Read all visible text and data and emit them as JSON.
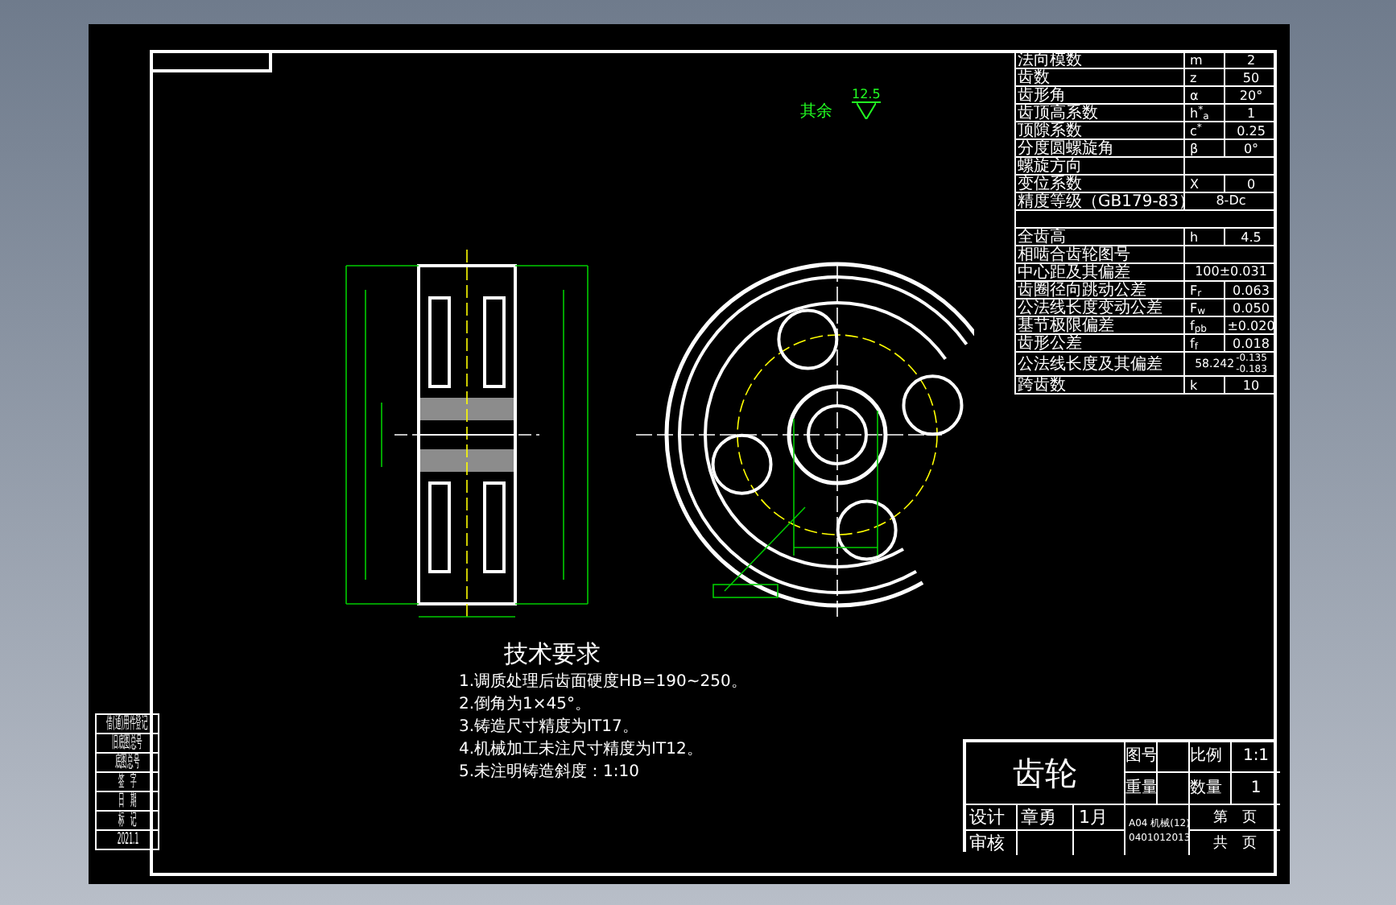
{
  "surface_finish": {
    "label": "其余",
    "value": "12.5"
  },
  "parameters": [
    {
      "kind": "full",
      "name": "法向模数",
      "symbol": "m",
      "value": "2"
    },
    {
      "kind": "full",
      "name": "齿数",
      "symbol": "z",
      "value": "50"
    },
    {
      "kind": "full",
      "name": "齿形角",
      "symbol": "α",
      "value": "20°"
    },
    {
      "kind": "full",
      "name": "齿顶高系数",
      "symbol": "h$^{*}$$_{a}$",
      "value": "1"
    },
    {
      "kind": "full",
      "name": "顶隙系数",
      "symbol": "c$^{*}$",
      "value": "0.25"
    },
    {
      "kind": "full",
      "name": "分度圆螺旋角",
      "symbol": "β",
      "value": "0°"
    },
    {
      "kind": "label",
      "name": "螺旋方向"
    },
    {
      "kind": "full",
      "name": "变位系数",
      "symbol": "X",
      "value": "0"
    },
    {
      "kind": "span",
      "name": "精度等级（GB179-83）",
      "value": "8-Dc"
    },
    {
      "kind": "blank"
    },
    {
      "kind": "full",
      "name": "全齿高",
      "symbol": "h",
      "value": "4.5"
    },
    {
      "kind": "label",
      "name": "相啮合齿轮图号"
    },
    {
      "kind": "span",
      "name": "中心距及其偏差",
      "value": "100±0.031"
    },
    {
      "kind": "full",
      "name": "齿圈径向跳动公差",
      "symbol": "F$_{r}$",
      "value": "0.063"
    },
    {
      "kind": "full",
      "name": "公法线长度变动公差",
      "symbol": "F$_{w}$",
      "value": "0.050"
    },
    {
      "kind": "full",
      "name": "基节极限偏差",
      "symbol": "f$_{pb}$",
      "value": "±0.020"
    },
    {
      "kind": "full",
      "name": "齿形公差",
      "symbol": "f$_{f}$",
      "value": "0.018"
    },
    {
      "kind": "tolerance",
      "name": "公法线长度及其偏差",
      "value": "58.242",
      "upper": "-0.135",
      "lower": "-0.183"
    },
    {
      "kind": "full",
      "name": "跨齿数",
      "symbol": "k",
      "value": "10"
    }
  ],
  "technical_requirements": {
    "title": "技术要求",
    "items": [
      "1.调质处理后齿面硬度HB=190~250。",
      "2.倒角为1×45°。",
      "3.铸造尺寸精度为IT17。",
      "4.机械加工未注尺寸精度为IT12。",
      "5.未注明铸造斜度：1:10"
    ]
  },
  "title_block": {
    "part_name": "齿轮",
    "drawing_no_label": "图号",
    "scale_label": "比例",
    "scale": "1:1",
    "weight_label": "重量",
    "quantity_label": "数量",
    "quantity": "1",
    "designer_label": "设计",
    "designer": "章勇",
    "date": "1月",
    "reviewer_label": "审核",
    "school": "A04 机械(12)",
    "student_no": "0401012013",
    "sheet_label": "第　页",
    "total_label": "共　页"
  },
  "side_table": [
    "借(通)用件登记",
    "旧底图总号",
    "底图总号",
    "签　字",
    "日　期",
    "标　记",
    "2021.1"
  ]
}
